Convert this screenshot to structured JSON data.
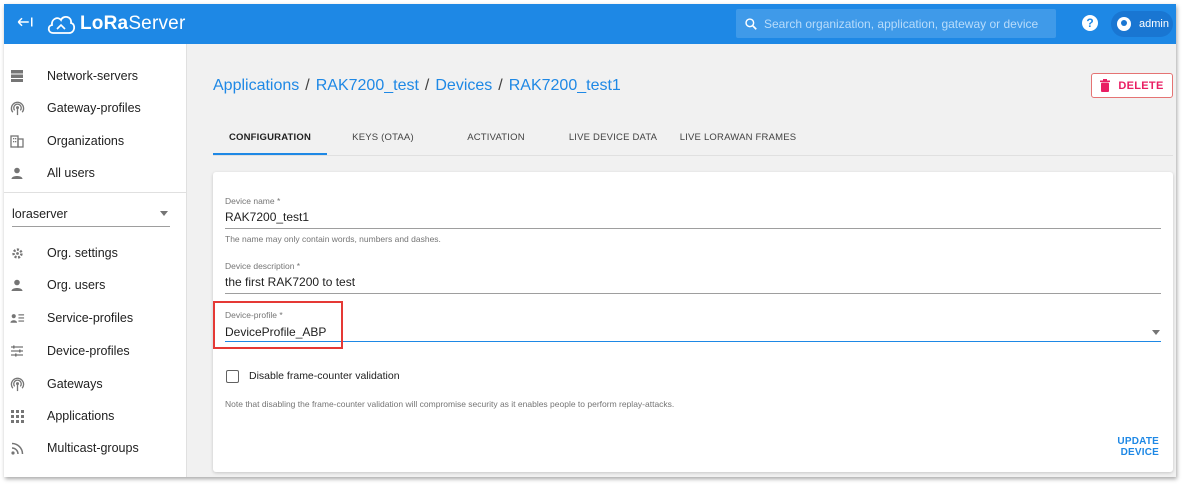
{
  "app": {
    "logo_text_bold": "LoRa",
    "logo_text_rest": "Server"
  },
  "topbar": {
    "search_placeholder": "Search organization, application, gateway or device",
    "help_label": "?",
    "user_name": "admin"
  },
  "sidebar": {
    "global_items": [
      {
        "label": "Network-servers",
        "icon": "server-icon"
      },
      {
        "label": "Gateway-profiles",
        "icon": "radio-tower-icon"
      },
      {
        "label": "Organizations",
        "icon": "domain-icon"
      },
      {
        "label": "All users",
        "icon": "person-icon"
      }
    ],
    "org_select": {
      "value": "loraserver"
    },
    "org_items": [
      {
        "label": "Org. settings",
        "icon": "settings-icon"
      },
      {
        "label": "Org. users",
        "icon": "person-icon"
      },
      {
        "label": "Service-profiles",
        "icon": "account-details-icon"
      },
      {
        "label": "Device-profiles",
        "icon": "tune-icon"
      },
      {
        "label": "Gateways",
        "icon": "radio-tower-icon"
      },
      {
        "label": "Applications",
        "icon": "apps-grid-icon"
      },
      {
        "label": "Multicast-groups",
        "icon": "rss-icon"
      }
    ]
  },
  "breadcrumb": {
    "items": [
      "Applications",
      "RAK7200_test",
      "Devices",
      "RAK7200_test1"
    ],
    "separator": "/"
  },
  "delete_button": {
    "label": "DELETE"
  },
  "tabs": [
    {
      "label": "CONFIGURATION",
      "active": true
    },
    {
      "label": "KEYS (OTAA)",
      "active": false
    },
    {
      "label": "ACTIVATION",
      "active": false
    },
    {
      "label": "LIVE DEVICE DATA",
      "active": false
    },
    {
      "label": "LIVE LORAWAN FRAMES",
      "active": false
    }
  ],
  "form": {
    "device_name": {
      "label": "Device name *",
      "value": "RAK7200_test1",
      "help": "The name may only contain words, numbers and dashes."
    },
    "device_description": {
      "label": "Device description *",
      "value": "the first RAK7200 to test"
    },
    "device_profile": {
      "label": "Device-profile *",
      "value": "DeviceProfile_ABP"
    },
    "frame_counter": {
      "label": "Disable frame-counter validation",
      "checked": false,
      "note": "Note that disabling the frame-counter validation will compromise security as it enables people to perform replay-attacks."
    },
    "update_button": {
      "label": "UPDATE DEVICE"
    }
  },
  "colors": {
    "primary": "#1e88e5",
    "danger": "#e91e63",
    "highlight": "#e53935"
  }
}
